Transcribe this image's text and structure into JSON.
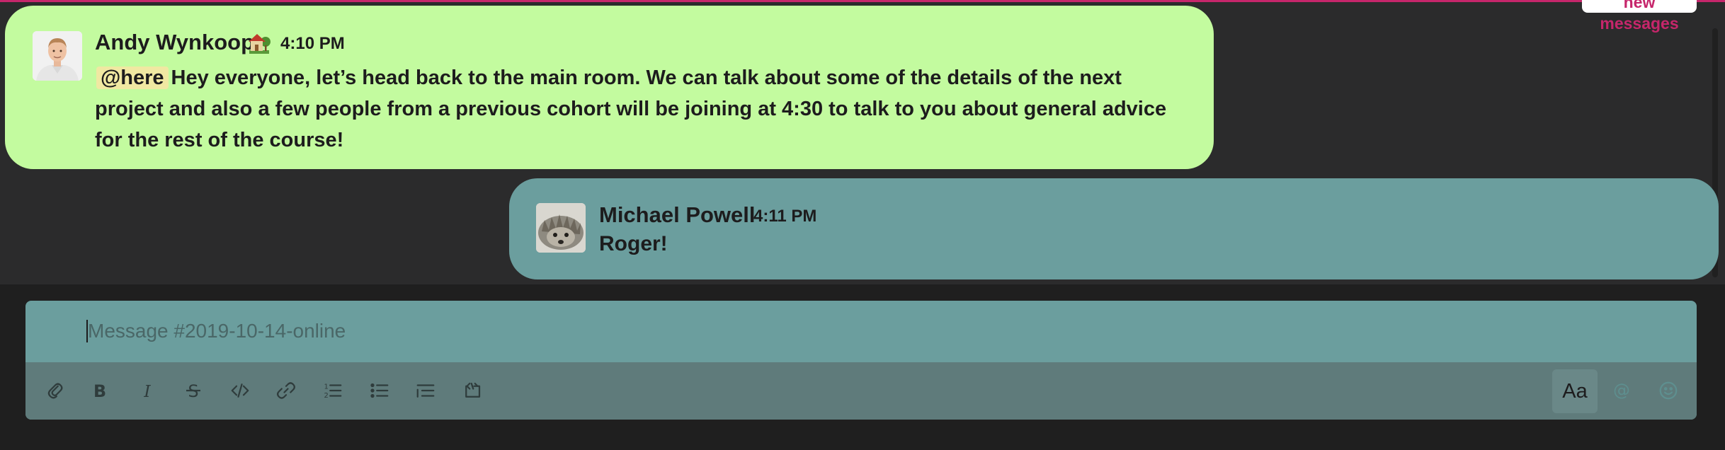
{
  "banner": {
    "new_messages_label": "new messages"
  },
  "messages": [
    {
      "author": "Andy Wynkoop",
      "status_icon": "house-with-garden-emoji",
      "time": "4:10 PM",
      "mention": "@here",
      "text": "Hey everyone, let’s head back to the main room. We can talk about some of the details of the next project and also a few people from a previous cohort will be joining at 4:30 to talk to you about general advice for the rest of the course!",
      "bubble_color": "#c3fb9f"
    },
    {
      "author": "Michael Powell",
      "time": "4:11 PM",
      "text": "Roger!",
      "bubble_color": "#6b9e9e"
    }
  ],
  "composer": {
    "placeholder": "Message #2019-10-14-online",
    "toolbar": {
      "left_icons": [
        "paperclip-icon",
        "bold-icon",
        "italic-icon",
        "strikethrough-icon",
        "code-icon",
        "link-icon",
        "ordered-list-icon",
        "bulleted-list-icon",
        "blockquote-icon",
        "code-block-icon"
      ],
      "format_label": "Aa",
      "right_icons": [
        "mention-icon",
        "emoji-icon"
      ]
    }
  },
  "colors": {
    "channel_bg": "#2b2b2c",
    "accent": "#c6266b",
    "composer_bg": "#6b9e9e",
    "toolbar_bg": "#5f7b7b"
  }
}
